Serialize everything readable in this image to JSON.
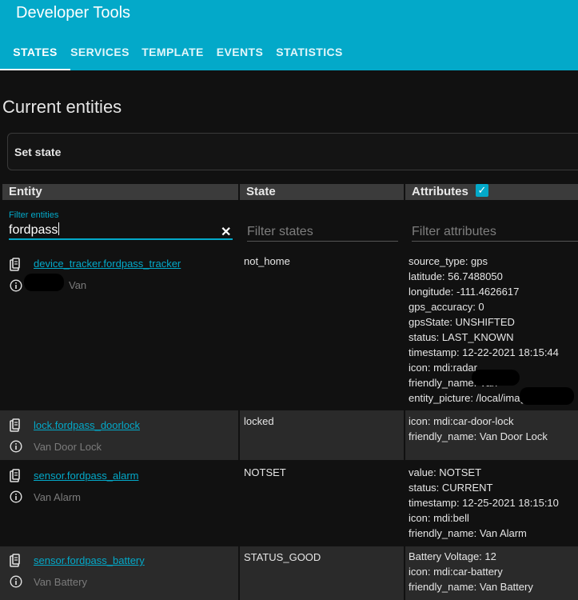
{
  "header": {
    "title": "Developer Tools",
    "tabs": [
      {
        "label": "STATES",
        "active": true
      },
      {
        "label": "SERVICES"
      },
      {
        "label": "TEMPLATE"
      },
      {
        "label": "EVENTS"
      },
      {
        "label": "STATISTICS"
      }
    ],
    "accent_color": "#03a9c9"
  },
  "main": {
    "title": "Current entities",
    "set_state_label": "Set state",
    "columns": {
      "entity": "Entity",
      "state": "State",
      "attributes": "Attributes"
    },
    "attributes_checked": true,
    "filters": {
      "entity_label": "Filter entities",
      "entity_value": "fordpass",
      "states_placeholder": "Filter states",
      "attributes_placeholder": "Filter attributes"
    },
    "rows": [
      {
        "entity_id": "device_tracker.fordpass_tracker",
        "friendly_name": "Van",
        "state": "not_home",
        "attributes": [
          "source_type: gps",
          "latitude: 56.7488050",
          "longitude: -111.4626617",
          "gps_accuracy: 0",
          "gpsState: UNSHIFTED",
          "status: LAST_KNOWN",
          "timestamp: 12-22-2021 18:15:44",
          "icon: mdi:radar",
          "friendly_name: Van",
          "entity_picture: /local/images/"
        ]
      },
      {
        "entity_id": "lock.fordpass_doorlock",
        "friendly_name": "Van Door Lock",
        "state": "locked",
        "attributes": [
          "icon: mdi:car-door-lock",
          "friendly_name: Van Door Lock"
        ]
      },
      {
        "entity_id": "sensor.fordpass_alarm",
        "friendly_name": "Van Alarm",
        "state": "NOTSET",
        "attributes": [
          "value: NOTSET",
          "status: CURRENT",
          "timestamp: 12-25-2021 18:15:10",
          "icon: mdi:bell",
          "friendly_name: Van Alarm"
        ]
      },
      {
        "entity_id": "sensor.fordpass_battery",
        "friendly_name": "Van Battery",
        "state": "STATUS_GOOD",
        "attributes": [
          "Battery Voltage: 12",
          "icon: mdi:car-battery",
          "friendly_name: Van Battery"
        ]
      }
    ]
  },
  "icons": {
    "clipboard": "clipboard-icon",
    "info": "info-icon",
    "clear": "close-icon",
    "check": "check-icon"
  }
}
